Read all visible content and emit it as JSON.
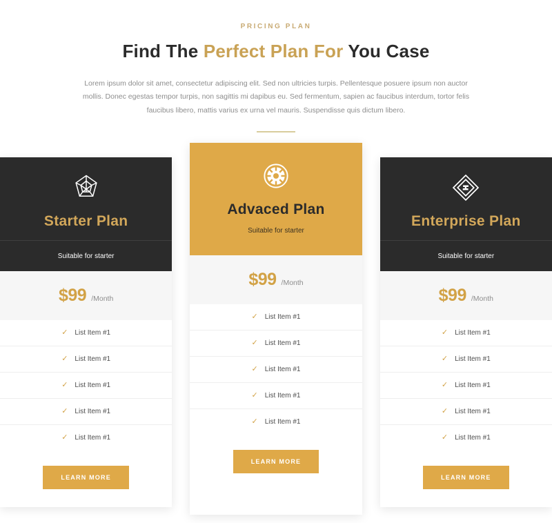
{
  "intro": {
    "eyebrow": "PRICING PLAN",
    "headline_part1": "Find The ",
    "headline_accent": "Perfect Plan For",
    "headline_part2": " You Case",
    "lead": "Lorem ipsum dolor sit amet, consectetur adipiscing elit. Sed non ultricies turpis. Pellentesque posuere ipsum non auctor mollis. Donec egestas tempor turpis, non sagittis mi dapibus eu. Sed fermentum, sapien ac faucibus interdum, tortor felis faucibus libero, mattis varius ex urna vel mauris. Suspendisse quis dictum libero."
  },
  "colors": {
    "gold": "#dfa948",
    "gold_text": "#d2a246",
    "dark": "#2b2b2b",
    "muted": "#8d8d8d",
    "price_band": "#f6f6f6"
  },
  "plans": [
    {
      "id": "starter",
      "icon": "polyhedron-icon",
      "name": "Starter Plan",
      "subtitle": "Suitable for starter",
      "price": "$99",
      "period": "/Month",
      "features": [
        "List Item #1",
        "List Item #1",
        "List Item #1",
        "List Item #1",
        "List Item #1"
      ],
      "cta": "LEARN MORE",
      "featured": false
    },
    {
      "id": "advaced",
      "icon": "cog-emblem-icon",
      "name": "Advaced Plan",
      "subtitle": "Suitable for starter",
      "price": "$99",
      "period": "/Month",
      "features": [
        "List Item #1",
        "List Item #1",
        "List Item #1",
        "List Item #1",
        "List Item #1"
      ],
      "cta": "LEARN MORE",
      "featured": true
    },
    {
      "id": "enterprise",
      "icon": "nested-diamond-icon",
      "name": "Enterprise Plan",
      "subtitle": "Suitable for starter",
      "price": "$99",
      "period": "/Month",
      "features": [
        "List Item #1",
        "List Item #1",
        "List Item #1",
        "List Item #1",
        "List Item #1"
      ],
      "cta": "LEARN MORE",
      "featured": false
    }
  ]
}
